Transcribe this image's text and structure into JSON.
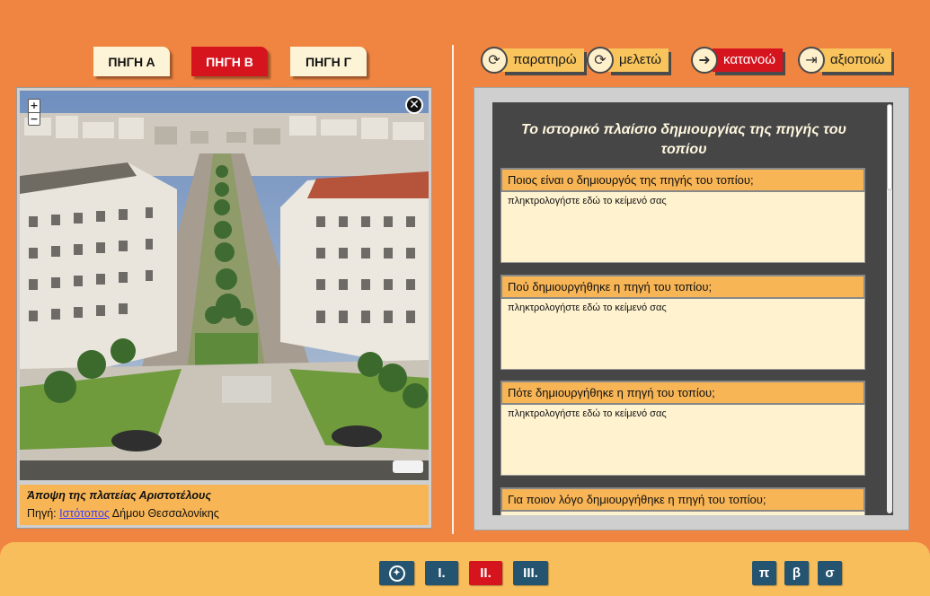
{
  "source_tabs": [
    {
      "label": "ΠΗΓΗ Α",
      "active": false
    },
    {
      "label": "ΠΗΓΗ Β",
      "active": true
    },
    {
      "label": "ΠΗΓΗ Γ",
      "active": false
    }
  ],
  "steps": [
    {
      "label": "παρατηρώ",
      "icon": "refresh-icon",
      "active": false
    },
    {
      "label": "μελετώ",
      "icon": "refresh-icon",
      "active": false
    },
    {
      "label": "κατανοώ",
      "icon": "sign-in-icon",
      "active": true
    },
    {
      "label": "αξιοποιώ",
      "icon": "sign-out-icon",
      "active": false
    }
  ],
  "image_panel": {
    "zoom_in": "+",
    "zoom_out": "−",
    "close": "✕",
    "caption_title": "Άποψη της πλατείας Αριστοτέλους",
    "caption_source_prefix": "Πηγή:",
    "caption_source_link": "Ιστότοπος",
    "caption_source_suffix": "Δήμου Θεσσαλονίκης"
  },
  "form": {
    "title": "Το ιστορικό πλαίσιο δημιουργίας της πηγής του τοπίου",
    "questions": [
      {
        "question": "Ποιος είναι ο δημιουργός της πηγής του τοπίου;",
        "placeholder": "πληκτρολογήστε εδώ το κείμενό σας"
      },
      {
        "question": "Πού δημιουργήθηκε η πηγή του τοπίου;",
        "placeholder": "πληκτρολογήστε εδώ το κείμενό σας"
      },
      {
        "question": "Πότε δημιουργήθηκε η πηγή του τοπίου;",
        "placeholder": "πληκτρολογήστε εδώ το κείμενό σας"
      },
      {
        "question": "Για ποιον λόγο δημιουργήθηκε η πηγή του τοπίου;",
        "placeholder": ""
      }
    ]
  },
  "bottom_nav": {
    "compass_icon": "compass-icon",
    "sections": [
      {
        "label": "I.",
        "active": false
      },
      {
        "label": "II.",
        "active": true
      },
      {
        "label": "III.",
        "active": false
      }
    ],
    "tools": [
      "π",
      "β",
      "σ"
    ]
  },
  "colors": {
    "background": "#f08542",
    "accent_red": "#d6141e",
    "tab_cream": "#fdf3d6",
    "label_orange": "#f7b556",
    "nav_blue": "#24546f"
  }
}
